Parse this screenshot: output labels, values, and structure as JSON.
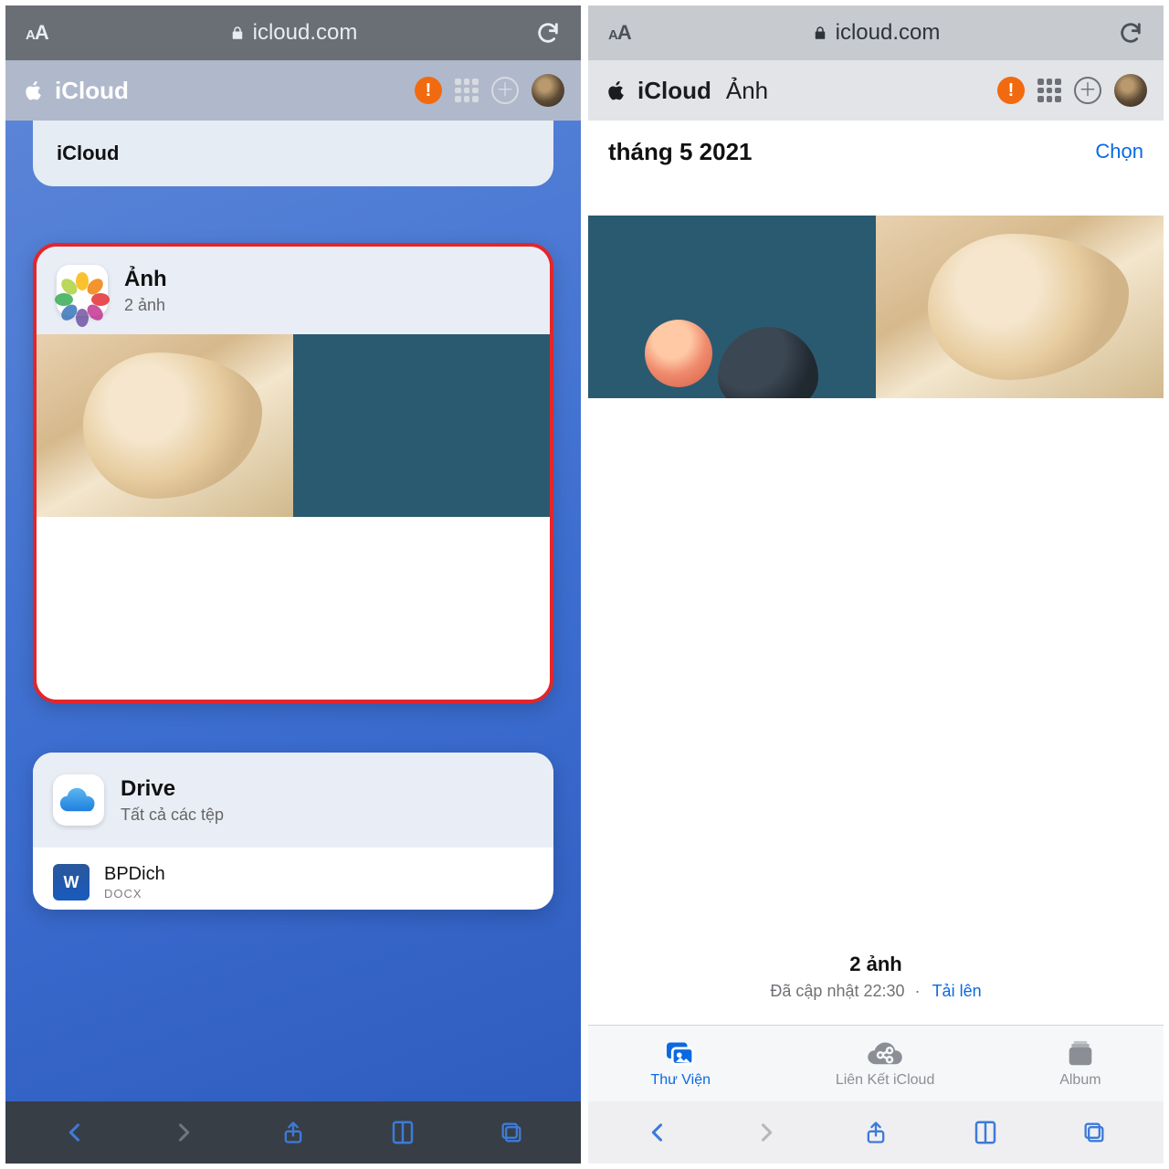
{
  "safari": {
    "domain": "icloud.com"
  },
  "left": {
    "header_brand": "iCloud",
    "top_card_label": "iCloud",
    "photos": {
      "title": "Ảnh",
      "subtitle": "2 ảnh"
    },
    "drive": {
      "title": "Drive",
      "subtitle": "Tất cả các tệp",
      "file_name": "BPDich",
      "file_ext": "DOCX"
    }
  },
  "right": {
    "header_brand": "iCloud",
    "header_sub": "Ảnh",
    "month": "tháng 5 2021",
    "select": "Chọn",
    "summary_count": "2 ảnh",
    "summary_updated": "Đã cập nhật 22:30",
    "summary_upload": "Tải lên",
    "tabs": {
      "library": "Thư Viện",
      "shared": "Liên Kết iCloud",
      "album": "Album"
    }
  }
}
